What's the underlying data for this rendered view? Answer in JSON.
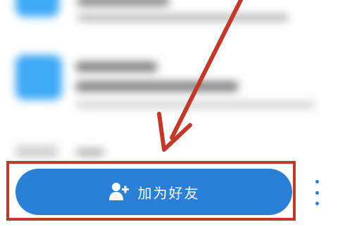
{
  "colors": {
    "accent": "#2b7fd6",
    "annotation": "#c0392b",
    "app_icon": "#3fa9f5"
  },
  "add_friend": {
    "label": "加为好友",
    "icon": "add-user-icon"
  },
  "more": {
    "icon": "more-vertical-icon"
  }
}
